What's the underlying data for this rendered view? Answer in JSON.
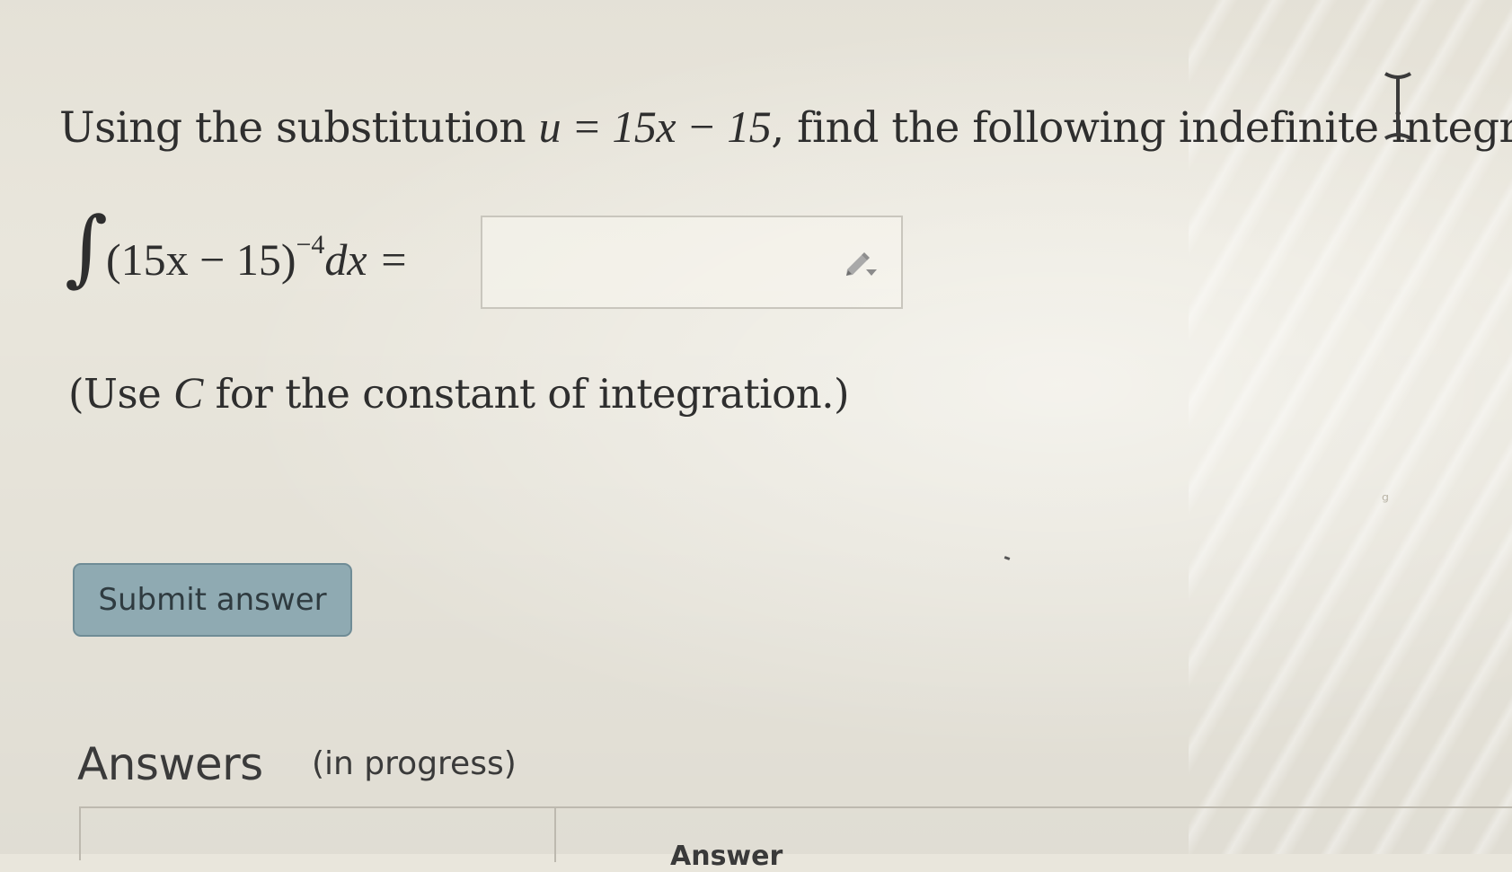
{
  "question": {
    "prefix": "Using the substitution ",
    "substitution_math": "u = 15x − 15",
    "suffix": ", find the following indefinite integral."
  },
  "integral": {
    "sign": "∫",
    "base": "(15x − 15)",
    "exponent": "−4",
    "differential": "dx =",
    "answer_value": ""
  },
  "hint": {
    "open": "(Use ",
    "constant": "C",
    "close": " for the constant of integration.)"
  },
  "submit": {
    "label": "Submit answer"
  },
  "answers": {
    "heading": "Answers",
    "status": "(in progress)",
    "column_header": "Answer"
  },
  "icons": {
    "pencil": "pencil-dropdown-icon",
    "cursor": "text-cursor-icon"
  },
  "colors": {
    "button_bg": "#8faab2",
    "button_border": "#6f8c96",
    "page_bg": "#e9e6dc"
  }
}
